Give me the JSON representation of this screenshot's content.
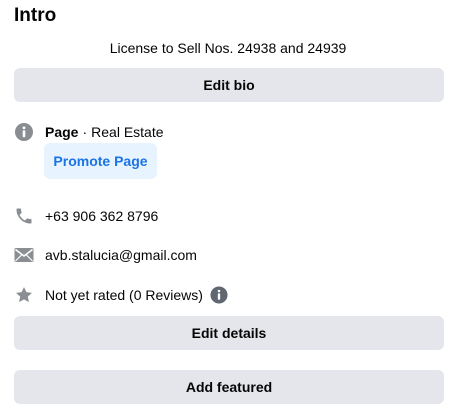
{
  "intro": {
    "title": "Intro",
    "bio": "License to Sell Nos. 24938 and 24939",
    "edit_bio_label": "Edit bio"
  },
  "page_info": {
    "icon": "info-icon",
    "type_label": "Page",
    "separator": "·",
    "category": "Real Estate",
    "promote_label": "Promote Page"
  },
  "contact": {
    "phone_icon": "phone-icon",
    "phone": "+63 906 362 8796",
    "email_icon": "envelope-icon",
    "email": "avb.stalucia@gmail.com"
  },
  "rating": {
    "icon": "star-icon",
    "text": "Not yet rated (0 Reviews)",
    "info_icon": "info-icon"
  },
  "actions": {
    "edit_details_label": "Edit details",
    "add_featured_label": "Add featured"
  },
  "colors": {
    "button_bg": "#e4e6eb",
    "promote_bg": "#e7f3ff",
    "promote_text": "#1b74e4",
    "icon": "#65676b",
    "text": "#050505"
  }
}
